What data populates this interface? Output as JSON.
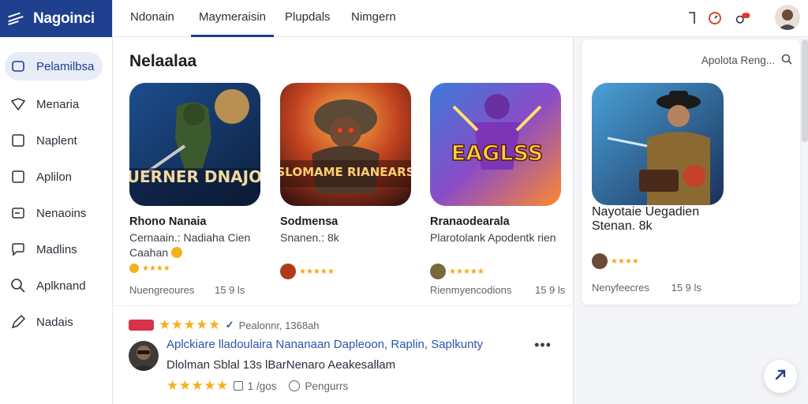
{
  "app": {
    "title": "Nagoinci"
  },
  "tabs": [
    {
      "label": "Ndonain"
    },
    {
      "label": "Maymeraisin",
      "active": true
    },
    {
      "label": "Plupdals"
    },
    {
      "label": "Nimgern"
    }
  ],
  "sidebar": {
    "items": [
      {
        "label": "Pelamilbsa",
        "icon": "folder-icon",
        "active": true
      },
      {
        "label": "Menaria",
        "icon": "diamond-icon"
      },
      {
        "label": "Naplent",
        "icon": "square-icon"
      },
      {
        "label": "Aplilon",
        "icon": "square-icon"
      },
      {
        "label": "Nenaoins",
        "icon": "image-icon"
      },
      {
        "label": "Madlins",
        "icon": "chat-icon"
      },
      {
        "label": "Aplknand",
        "icon": "search-icon"
      },
      {
        "label": "Nadais",
        "icon": "pen-icon"
      }
    ]
  },
  "main": {
    "section_title": "Nelaalaa",
    "cards": [
      {
        "name": "Rhono Nanaia",
        "sub": "Cernaain.: Nadiaha Cien",
        "sub2": "Caahan",
        "art_text": "VUERNER DNAJOD",
        "meta_left": "Nuengreoures",
        "meta_right": "15 9 ls",
        "rating": "★★★★"
      },
      {
        "name": "Sodmensa",
        "sub": "Snanen.: 8k",
        "sub2": "",
        "art_text": "SLOMAME RIANEARS",
        "meta_left": "",
        "meta_right": "",
        "rating": "★★★★★"
      },
      {
        "name": "Rranaodearala",
        "sub": "Plarotolank Apodentk rien",
        "sub2": "",
        "art_text": "EAGLSS",
        "meta_left": "Rienmyencodions",
        "meta_right": "15 9 ls",
        "rating": "★★★★★"
      }
    ],
    "review": {
      "badge": "Pealonnr, 1368ah",
      "stars": "★★★★★",
      "title": "Aplckiare lladoulaira Nananaan Dapleoon, Raplin, Saplkunty",
      "body": "Dlolman Sblal 13s lBarNenaro Aeakesallam",
      "foot_count": "1 /gos",
      "foot_label": "Pengurrs",
      "more": "•••"
    }
  },
  "right": {
    "search_label": "Apolota Reng...",
    "card": {
      "name": "Nayotaie Uegadien",
      "sub": "Stenan. 8k",
      "meta_left": "Nenyfeecres",
      "meta_right": "15 9 ls",
      "rating": "★★★★"
    }
  },
  "colors": {
    "brand": "#1f3f8f",
    "star": "#f2b21b",
    "link": "#2a55a8"
  }
}
